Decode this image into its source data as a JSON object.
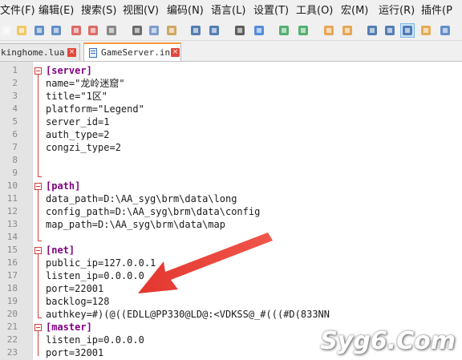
{
  "menu": [
    {
      "label": "文件(F)"
    },
    {
      "label": "编辑(E)"
    },
    {
      "label": "搜索(S)"
    },
    {
      "label": "视图(V)"
    },
    {
      "label": "编码(N)"
    },
    {
      "label": "语言(L)"
    },
    {
      "label": "设置(T)"
    },
    {
      "label": "工具(O)"
    },
    {
      "label": "宏(M)"
    },
    {
      "label": "运行(R)"
    },
    {
      "label": "插件(P"
    }
  ],
  "toolbar": {
    "icons": [
      "new-file-icon",
      "open-file-icon",
      "save-icon",
      "save-all-icon",
      "close-icon",
      "close-all-icon",
      "print-icon",
      "cut-icon",
      "copy-icon",
      "paste-icon",
      "undo-icon",
      "redo-icon",
      "find-icon",
      "replace-icon",
      "zoom-in-icon",
      "zoom-out-icon",
      "sync-vertical-icon",
      "sync-horizontal-icon",
      "word-wrap-icon",
      "show-all-chars-icon",
      "indent-guide-icon",
      "doc-map-icon",
      "function-list-icon"
    ]
  },
  "tabs": [
    {
      "label": "kinghome.lua",
      "close": "×"
    },
    {
      "label": "GameServer.ini",
      "close": "×"
    }
  ],
  "editor": {
    "lines": [
      {
        "n": "1",
        "text": "[server]",
        "kind": "section"
      },
      {
        "n": "2",
        "text": "name=\"龙岭迷窟\"",
        "kind": "kv"
      },
      {
        "n": "3",
        "text": "title=\"1区\"",
        "kind": "kv"
      },
      {
        "n": "4",
        "text": "platform=\"Legend\"",
        "kind": "kv"
      },
      {
        "n": "5",
        "text": "server_id=1",
        "kind": "kv"
      },
      {
        "n": "6",
        "text": "auth_type=2",
        "kind": "kv"
      },
      {
        "n": "7",
        "text": "congzi_type=2",
        "kind": "kv"
      },
      {
        "n": "8",
        "text": "",
        "kind": "blank"
      },
      {
        "n": "9",
        "text": "",
        "kind": "blank"
      },
      {
        "n": "10",
        "text": "[path]",
        "kind": "section"
      },
      {
        "n": "11",
        "text": "data_path=D:\\AA_syg\\brm\\data\\long",
        "kind": "kv"
      },
      {
        "n": "12",
        "text": "config_path=D:\\AA_syg\\brm\\data\\config",
        "kind": "kv"
      },
      {
        "n": "13",
        "text": "map_path=D:\\AA_syg\\brm\\data\\map",
        "kind": "kv"
      },
      {
        "n": "14",
        "text": "",
        "kind": "blank"
      },
      {
        "n": "15",
        "text": "[net]",
        "kind": "section"
      },
      {
        "n": "16",
        "text": "public_ip=127.0.0.1",
        "kind": "kv"
      },
      {
        "n": "17",
        "text": "listen_ip=0.0.0.0",
        "kind": "kv"
      },
      {
        "n": "18",
        "text": "port=22001",
        "kind": "kv"
      },
      {
        "n": "19",
        "text": "backlog=128",
        "kind": "kv"
      },
      {
        "n": "20",
        "text": "authkey=#)(@((EDLL@PP330@LD@:<VDKSS@_#(((#D(833NN",
        "kind": "kv"
      },
      {
        "n": "21",
        "text": "[master]",
        "kind": "section"
      },
      {
        "n": "22",
        "text": "listen_ip=0.0.0.0",
        "kind": "kv"
      },
      {
        "n": "23",
        "text": "port=32001",
        "kind": "kv"
      }
    ]
  },
  "colors": {
    "section": "#7f007f",
    "arrow": "#e8423a",
    "tab_accent": "#f79a3c",
    "fold": "#d23c3c"
  },
  "watermark": "Syg6.Com"
}
